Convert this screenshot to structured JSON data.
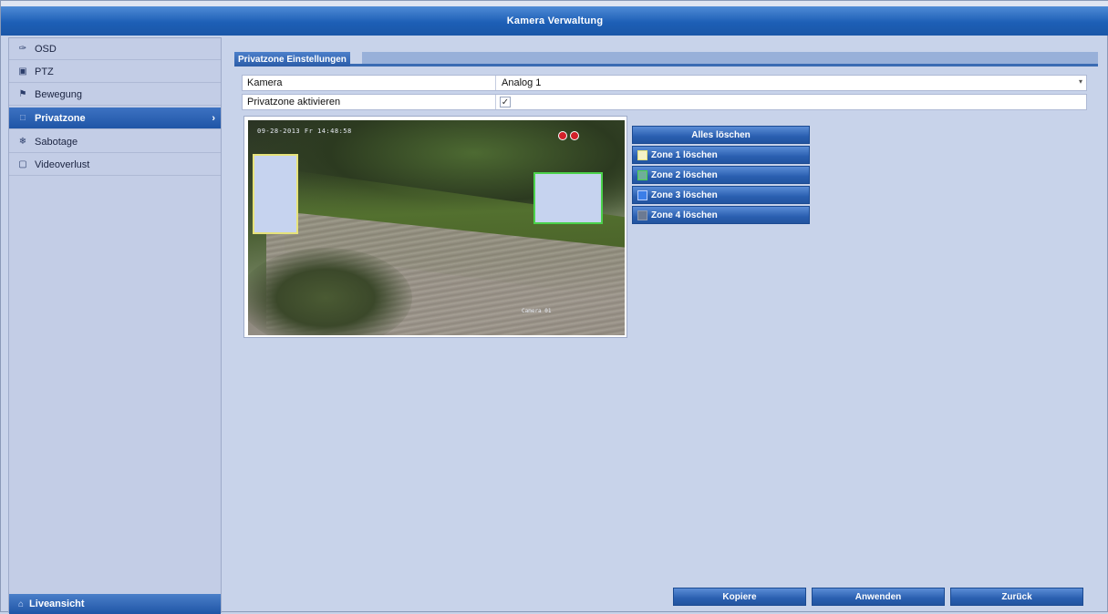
{
  "window": {
    "title": "Kamera Verwaltung"
  },
  "sidebar": {
    "items": [
      {
        "label": "OSD",
        "icon": "osd-icon"
      },
      {
        "label": "PTZ",
        "icon": "ptz-icon"
      },
      {
        "label": "Bewegung",
        "icon": "motion-icon"
      },
      {
        "label": "Privatzone",
        "icon": "privacy-icon",
        "active": true
      },
      {
        "label": "Sabotage",
        "icon": "tamper-icon"
      },
      {
        "label": "Videoverlust",
        "icon": "video-loss-icon"
      }
    ],
    "live_label": "Liveansicht"
  },
  "section": {
    "title": "Privatzone Einstellungen"
  },
  "form": {
    "camera_label": "Kamera",
    "camera_value": "Analog 1",
    "enable_label": "Privatzone aktivieren",
    "enable_checked": true
  },
  "preview": {
    "osd_timestamp": "09-28-2013 Fr 14:48:58",
    "osd_camera": "Camera 01"
  },
  "zones": {
    "clear_all": "Alles löschen",
    "buttons": [
      {
        "label": "Zone 1 löschen",
        "color": "#e6e27a"
      },
      {
        "label": "Zone 2 löschen",
        "color": "#4bd14b"
      },
      {
        "label": "Zone 3 löschen",
        "color": "#3b7ee8"
      },
      {
        "label": "Zone 4 löschen",
        "color": "#6c7a92"
      }
    ]
  },
  "footer": {
    "copy": "Kopiere",
    "apply": "Anwenden",
    "back": "Zurück"
  },
  "colors": {
    "accent": "#1f55a6",
    "panel": "#c8d3ea"
  }
}
